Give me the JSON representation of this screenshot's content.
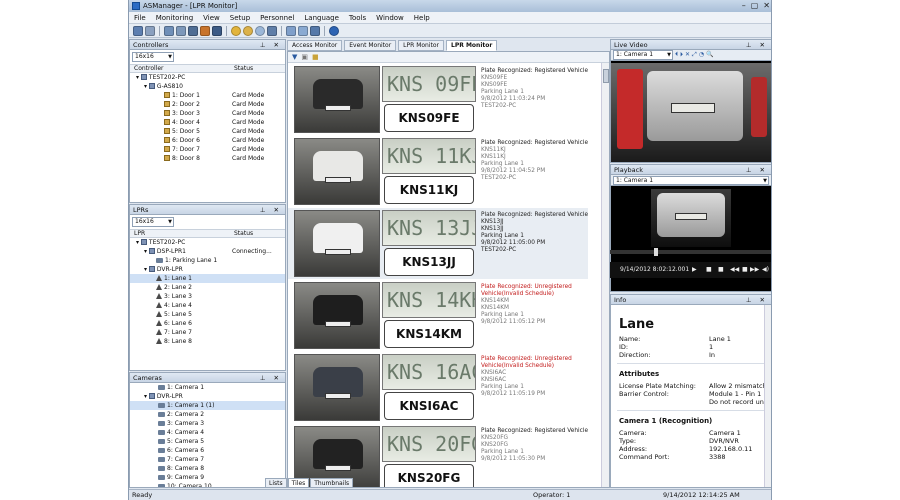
{
  "window": {
    "title": "ASManager - [LPR Monitor]",
    "controls": [
      "–",
      "▢",
      "✕"
    ]
  },
  "menu": [
    "File",
    "Monitoring",
    "View",
    "Setup",
    "Personnel",
    "Language",
    "Tools",
    "Window",
    "Help"
  ],
  "controllers": {
    "title": "Controllers",
    "combo": "16x16",
    "columns": [
      "Controller",
      "Status"
    ],
    "pc": "TEST202-PC",
    "device": "G-AS810",
    "doors": [
      {
        "label": "1: Door 1",
        "status": "Card Mode"
      },
      {
        "label": "2: Door 2",
        "status": "Card Mode"
      },
      {
        "label": "3: Door 3",
        "status": "Card Mode"
      },
      {
        "label": "4: Door 4",
        "status": "Card Mode"
      },
      {
        "label": "5: Door 5",
        "status": "Card Mode"
      },
      {
        "label": "6: Door 6",
        "status": "Card Mode"
      },
      {
        "label": "7: Door 7",
        "status": "Card Mode"
      },
      {
        "label": "8: Door 8",
        "status": "Card Mode"
      }
    ]
  },
  "lprs": {
    "title": "LPRs",
    "combo": "16x16",
    "columns": [
      "LPR",
      "Status"
    ],
    "pc": "TEST202-PC",
    "dsp": {
      "label": "DSP-LPR1",
      "status": "Connecting..."
    },
    "parking": "1: Parking Lane 1",
    "dvr": "DVR-LPR",
    "lanes": [
      "1: Lane 1",
      "2: Lane 2",
      "3: Lane 3",
      "4: Lane 4",
      "5: Lane 5",
      "6: Lane 6",
      "7: Lane 7",
      "8: Lane 8"
    ]
  },
  "cameras": {
    "title": "Cameras",
    "first": "1: Camera 1",
    "dvr": "DVR-LPR",
    "items": [
      "1: Camera 1 (1)",
      "2: Camera 2",
      "3: Camera 3",
      "4: Camera 4",
      "5: Camera 5",
      "6: Camera 6",
      "7: Camera 7",
      "8: Camera 8",
      "9: Camera 9",
      "10: Camera 10"
    ]
  },
  "tabs": [
    "Access Monitor",
    "Event Monitor",
    "LPR Monitor",
    "LPR Monitor"
  ],
  "entries": [
    {
      "plate_img": "KNS 09FE",
      "ocr": "KNS09FE",
      "event": "Plate Recognized: Registered Vehicle",
      "red": false,
      "l1": "KNS09FE",
      "l2": "KNS09FE",
      "lane": "Parking Lane 1",
      "time": "9/8/2012 11:03:24 PM",
      "pc": "TEST202-PC",
      "car": "#2a2a2a"
    },
    {
      "plate_img": "KNS 11KJ",
      "ocr": "KNS11KJ",
      "event": "Plate Recognized: Registered Vehicle",
      "red": false,
      "l1": "KNS11KJ",
      "l2": "KNS11KJ",
      "lane": "Parking Lane 1",
      "time": "9/8/2012 11:04:52 PM",
      "pc": "TEST202-PC",
      "car": "#e8e8e6"
    },
    {
      "plate_img": "KNS 13JJ",
      "ocr": "KNS13JJ",
      "event": "Plate Recognized: Registered Vehicle",
      "red": false,
      "l1": "KNS13JJ",
      "l2": "KNS13JJ",
      "lane": "Parking Lane 1",
      "time": "9/8/2012 11:05:00 PM",
      "pc": "TEST202-PC",
      "car": "#f0f0f0"
    },
    {
      "plate_img": "KNS 14KH",
      "ocr": "KNS14KM",
      "event": "Plate Recognized: Unregistered Vehicle(Invalid Schedule)",
      "red": true,
      "l1": "KNS14KM",
      "l2": "KNS14KM",
      "lane": "Parking Lane 1",
      "time": "9/8/2012 11:05:12 PM",
      "pc": "",
      "car": "#1e1e1e"
    },
    {
      "plate_img": "KNS 16AC",
      "ocr": "KNSI6AC",
      "event": "Plate Recognized: Unregistered Vehicle(Invalid Schedule)",
      "red": true,
      "l1": "KNSI6AC",
      "l2": "KNSI6AC",
      "lane": "Parking Lane 1",
      "time": "9/8/2012 11:05:19 PM",
      "pc": "",
      "car": "#3a3f48"
    },
    {
      "plate_img": "KNS 20FG",
      "ocr": "KNS20FG",
      "event": "Plate Recognized: Registered Vehicle",
      "red": false,
      "l1": "KNS20FG",
      "l2": "KNS20FG",
      "lane": "Parking Lane 1",
      "time": "9/8/2012 11:05:30 PM",
      "pc": "",
      "car": "#222"
    }
  ],
  "bottom_tabs": [
    "Lists",
    "Tiles",
    "Thumbnails"
  ],
  "live": {
    "title": "Live Video",
    "combo": "1: Camera 1"
  },
  "playback": {
    "title": "Playback",
    "combo": "1: Camera 1",
    "timestamp": "9/14/2012 8:02:12.001",
    "buttons": [
      "▶",
      "■",
      "■",
      "◀◀",
      "■",
      "▶▶",
      "◀)"
    ]
  },
  "info": {
    "title": "Info",
    "heading": "Lane",
    "basic": [
      [
        "Name:",
        "Lane 1"
      ],
      [
        "ID:",
        "1"
      ],
      [
        "Direction:",
        "In"
      ]
    ],
    "attributes_title": "Attributes",
    "attributes": [
      [
        "License Plate Matching:",
        "Allow 2 mismatch"
      ],
      [
        "Barrier Control:",
        "Module 1 - Pin 1"
      ],
      [
        "",
        "Do not record un"
      ]
    ],
    "camera_title": "Camera 1 (Recognition)",
    "camera": [
      [
        "Camera:",
        "Camera 1"
      ],
      [
        "Type:",
        "DVR/NVR"
      ],
      [
        "Address:",
        "192.168.0.11"
      ],
      [
        "Command Port:",
        "3388"
      ]
    ]
  },
  "status": {
    "left": "Ready",
    "operator": "Operator: 1",
    "datetime": "9/14/2012 12:14:25 AM"
  }
}
